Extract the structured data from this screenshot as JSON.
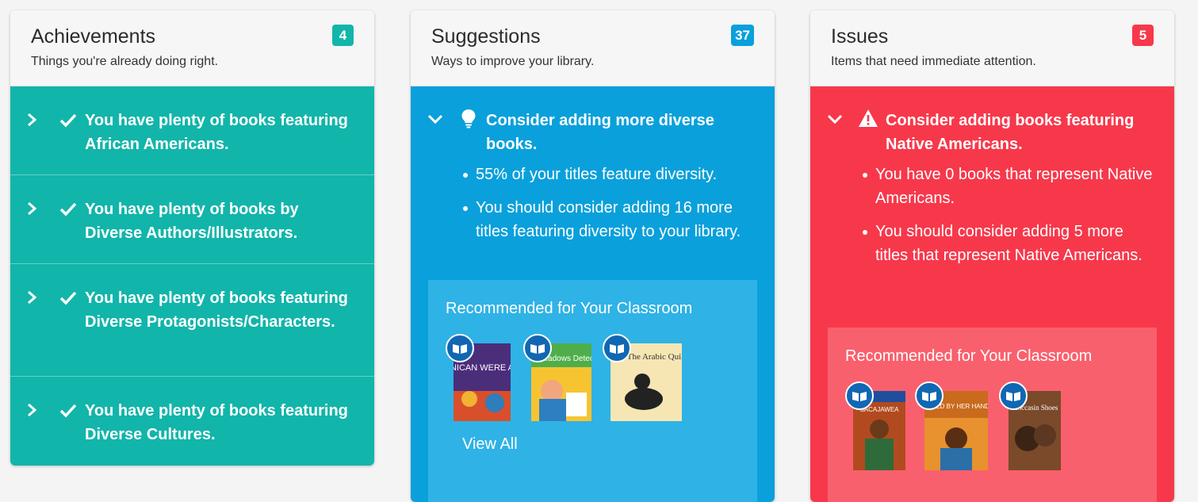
{
  "achievements": {
    "title": "Achievements",
    "subtitle": "Things you're already doing right.",
    "count": "4",
    "badge_color": "#12b5aa",
    "items": [
      {
        "label": "You have plenty of books featuring African Americans."
      },
      {
        "label": "You have plenty of books by Diverse Authors/Illustrators."
      },
      {
        "label": "You have plenty of books featuring Diverse Protagonists/Characters."
      },
      {
        "label": "You have plenty of books featuring Diverse Cultures."
      }
    ]
  },
  "suggestions": {
    "title": "Suggestions",
    "subtitle": "Ways to improve your library.",
    "count": "37",
    "badge_color": "#0aa0db",
    "heading": "Consider adding more diverse books.",
    "bullets": [
      "55% of your titles feature diversity.",
      "You should consider adding 16 more titles featuring diversity to your library."
    ],
    "recommended_title": "Recommended for Your Classroom",
    "view_all": "View All",
    "books": [
      {
        "cover_text": "IF DOMINICAN WERE A COLOR"
      },
      {
        "cover_text": "Sweet Meadows Detectives"
      },
      {
        "cover_text": "The Arabic Quilt"
      }
    ]
  },
  "issues": {
    "title": "Issues",
    "subtitle": "Items that need immediate attention.",
    "count": "5",
    "badge_color": "#f7384b",
    "heading": "Consider adding books featuring Native Americans.",
    "bullets": [
      "You have 0 books that represent Native Americans.",
      "You should consider adding 5 more titles that represent Native Americans."
    ],
    "recommended_title": "Recommended for Your Classroom",
    "books": [
      {
        "cover_text": "SACAJAWEA"
      },
      {
        "cover_text": "SHAPED BY HER HANDS"
      },
      {
        "cover_text": "Moccasin Shoes"
      }
    ]
  }
}
